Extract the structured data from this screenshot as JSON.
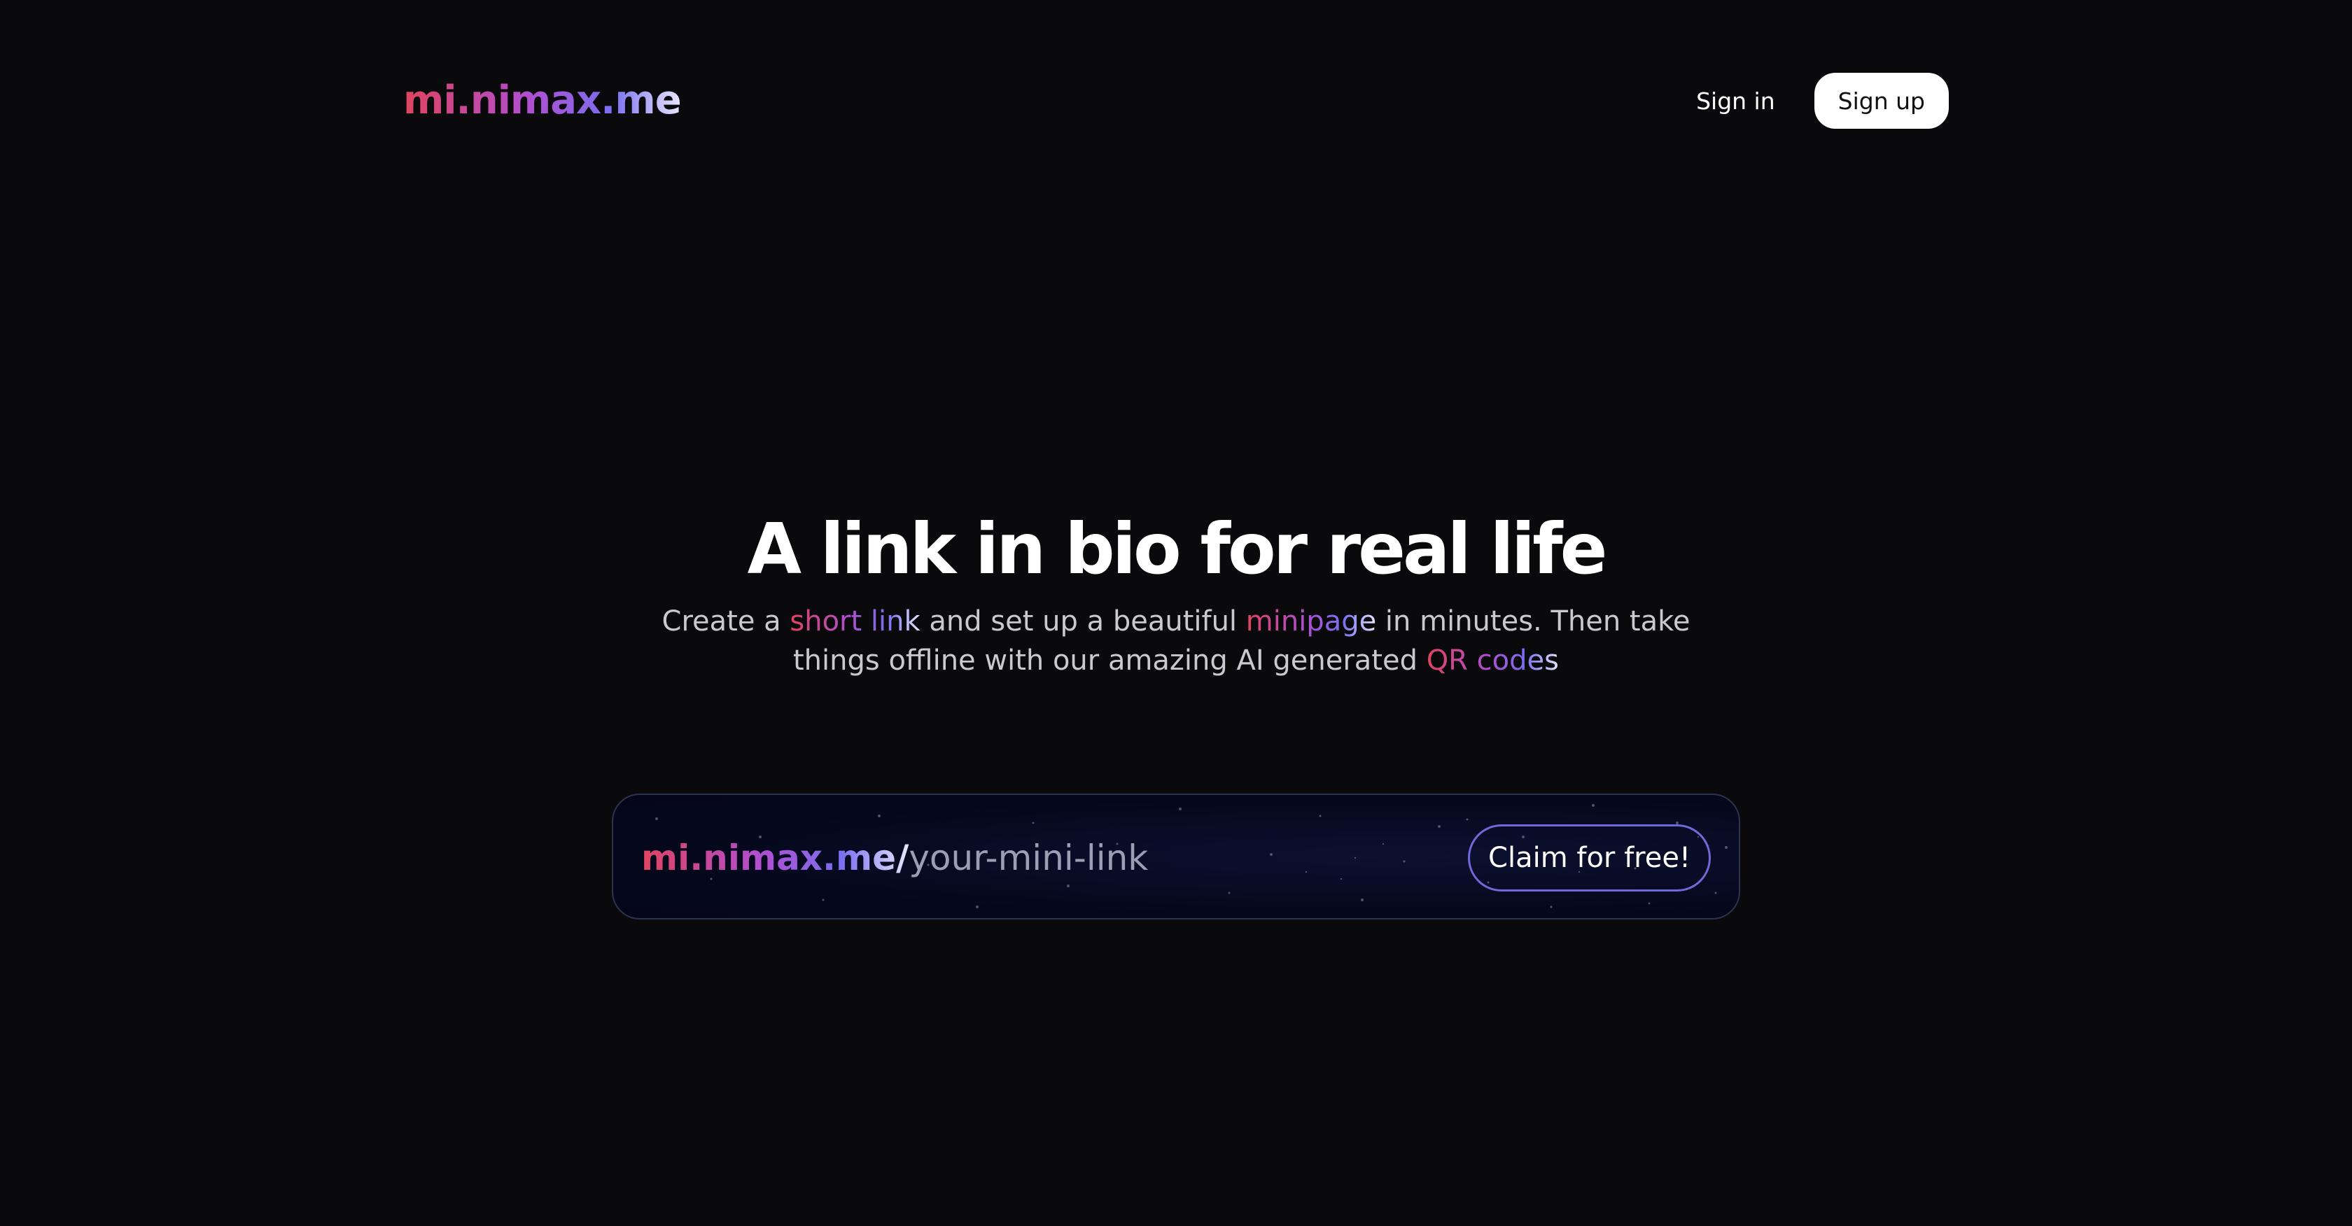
{
  "header": {
    "logo": "mi.nimax.me",
    "signin_label": "Sign in",
    "signup_label": "Sign up"
  },
  "hero": {
    "title": "A link in bio for real life",
    "sub_1": "Create a ",
    "hl_short_link": "short link",
    "sub_2": " and set up a beautiful ",
    "hl_minipage": "minipage",
    "sub_3": " in minutes. Then take things offline with our amazing AI generated ",
    "hl_qr": "QR codes"
  },
  "claim": {
    "domain": "mi.nimax.me/",
    "placeholder": "your-mini-link",
    "button_label": "Claim for free!"
  },
  "colors": {
    "background": "#0a0a0d",
    "gradient_start": "#e0435f",
    "gradient_mid": "#b04ed0",
    "gradient_end": "#e8e6ff"
  }
}
